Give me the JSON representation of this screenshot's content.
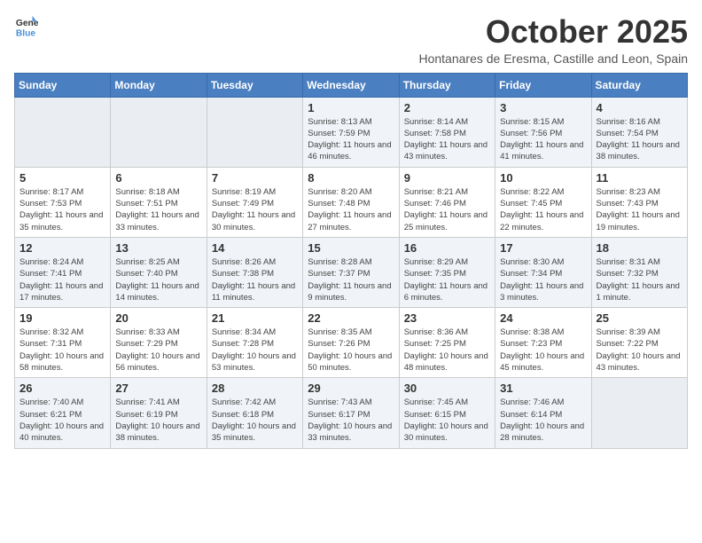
{
  "header": {
    "logo_line1": "General",
    "logo_line2": "Blue",
    "month": "October 2025",
    "subtitle": "Hontanares de Eresma, Castille and Leon, Spain"
  },
  "weekdays": [
    "Sunday",
    "Monday",
    "Tuesday",
    "Wednesday",
    "Thursday",
    "Friday",
    "Saturday"
  ],
  "weeks": [
    [
      {
        "day": "",
        "info": ""
      },
      {
        "day": "",
        "info": ""
      },
      {
        "day": "",
        "info": ""
      },
      {
        "day": "1",
        "info": "Sunrise: 8:13 AM\nSunset: 7:59 PM\nDaylight: 11 hours and 46 minutes."
      },
      {
        "day": "2",
        "info": "Sunrise: 8:14 AM\nSunset: 7:58 PM\nDaylight: 11 hours and 43 minutes."
      },
      {
        "day": "3",
        "info": "Sunrise: 8:15 AM\nSunset: 7:56 PM\nDaylight: 11 hours and 41 minutes."
      },
      {
        "day": "4",
        "info": "Sunrise: 8:16 AM\nSunset: 7:54 PM\nDaylight: 11 hours and 38 minutes."
      }
    ],
    [
      {
        "day": "5",
        "info": "Sunrise: 8:17 AM\nSunset: 7:53 PM\nDaylight: 11 hours and 35 minutes."
      },
      {
        "day": "6",
        "info": "Sunrise: 8:18 AM\nSunset: 7:51 PM\nDaylight: 11 hours and 33 minutes."
      },
      {
        "day": "7",
        "info": "Sunrise: 8:19 AM\nSunset: 7:49 PM\nDaylight: 11 hours and 30 minutes."
      },
      {
        "day": "8",
        "info": "Sunrise: 8:20 AM\nSunset: 7:48 PM\nDaylight: 11 hours and 27 minutes."
      },
      {
        "day": "9",
        "info": "Sunrise: 8:21 AM\nSunset: 7:46 PM\nDaylight: 11 hours and 25 minutes."
      },
      {
        "day": "10",
        "info": "Sunrise: 8:22 AM\nSunset: 7:45 PM\nDaylight: 11 hours and 22 minutes."
      },
      {
        "day": "11",
        "info": "Sunrise: 8:23 AM\nSunset: 7:43 PM\nDaylight: 11 hours and 19 minutes."
      }
    ],
    [
      {
        "day": "12",
        "info": "Sunrise: 8:24 AM\nSunset: 7:41 PM\nDaylight: 11 hours and 17 minutes."
      },
      {
        "day": "13",
        "info": "Sunrise: 8:25 AM\nSunset: 7:40 PM\nDaylight: 11 hours and 14 minutes."
      },
      {
        "day": "14",
        "info": "Sunrise: 8:26 AM\nSunset: 7:38 PM\nDaylight: 11 hours and 11 minutes."
      },
      {
        "day": "15",
        "info": "Sunrise: 8:28 AM\nSunset: 7:37 PM\nDaylight: 11 hours and 9 minutes."
      },
      {
        "day": "16",
        "info": "Sunrise: 8:29 AM\nSunset: 7:35 PM\nDaylight: 11 hours and 6 minutes."
      },
      {
        "day": "17",
        "info": "Sunrise: 8:30 AM\nSunset: 7:34 PM\nDaylight: 11 hours and 3 minutes."
      },
      {
        "day": "18",
        "info": "Sunrise: 8:31 AM\nSunset: 7:32 PM\nDaylight: 11 hours and 1 minute."
      }
    ],
    [
      {
        "day": "19",
        "info": "Sunrise: 8:32 AM\nSunset: 7:31 PM\nDaylight: 10 hours and 58 minutes."
      },
      {
        "day": "20",
        "info": "Sunrise: 8:33 AM\nSunset: 7:29 PM\nDaylight: 10 hours and 56 minutes."
      },
      {
        "day": "21",
        "info": "Sunrise: 8:34 AM\nSunset: 7:28 PM\nDaylight: 10 hours and 53 minutes."
      },
      {
        "day": "22",
        "info": "Sunrise: 8:35 AM\nSunset: 7:26 PM\nDaylight: 10 hours and 50 minutes."
      },
      {
        "day": "23",
        "info": "Sunrise: 8:36 AM\nSunset: 7:25 PM\nDaylight: 10 hours and 48 minutes."
      },
      {
        "day": "24",
        "info": "Sunrise: 8:38 AM\nSunset: 7:23 PM\nDaylight: 10 hours and 45 minutes."
      },
      {
        "day": "25",
        "info": "Sunrise: 8:39 AM\nSunset: 7:22 PM\nDaylight: 10 hours and 43 minutes."
      }
    ],
    [
      {
        "day": "26",
        "info": "Sunrise: 7:40 AM\nSunset: 6:21 PM\nDaylight: 10 hours and 40 minutes."
      },
      {
        "day": "27",
        "info": "Sunrise: 7:41 AM\nSunset: 6:19 PM\nDaylight: 10 hours and 38 minutes."
      },
      {
        "day": "28",
        "info": "Sunrise: 7:42 AM\nSunset: 6:18 PM\nDaylight: 10 hours and 35 minutes."
      },
      {
        "day": "29",
        "info": "Sunrise: 7:43 AM\nSunset: 6:17 PM\nDaylight: 10 hours and 33 minutes."
      },
      {
        "day": "30",
        "info": "Sunrise: 7:45 AM\nSunset: 6:15 PM\nDaylight: 10 hours and 30 minutes."
      },
      {
        "day": "31",
        "info": "Sunrise: 7:46 AM\nSunset: 6:14 PM\nDaylight: 10 hours and 28 minutes."
      },
      {
        "day": "",
        "info": ""
      }
    ]
  ]
}
